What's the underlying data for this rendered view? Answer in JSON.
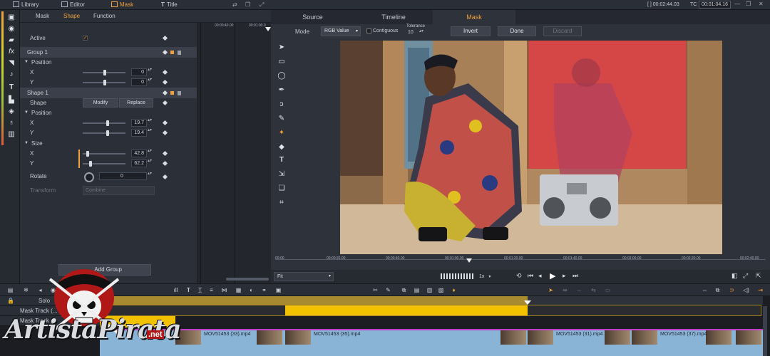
{
  "app": {
    "top_tabs": [
      "Library",
      "Editor",
      "Mask",
      "Title"
    ],
    "active_tab": "Mask",
    "timecode": "[ ] 00:02:44.03",
    "tc_label": "TC",
    "tc_value": "00:01:04.16"
  },
  "panel": {
    "tabs": [
      "Mask",
      "Shape",
      "Function"
    ],
    "active_tab": "Shape",
    "ruler": [
      "00:00:40.00",
      "00:01:00.0"
    ],
    "active_label": "Active",
    "group_label": "Group 1",
    "position_label": "Position",
    "x_label": "X",
    "y_label": "Y",
    "group_pos_x": "0",
    "group_pos_y": "0",
    "shape_label": "Shape 1",
    "shape_row_label": "Shape",
    "modify_btn": "Modify",
    "replace_btn": "Replace",
    "shape_pos_x": "19.7",
    "shape_pos_y": "19.4",
    "size_label": "Size",
    "size_x": "42.8",
    "size_y": "62.2",
    "rotate_label": "Rotate",
    "rotate_value": "0",
    "transform_label": "Transform",
    "transform_value": "Combine",
    "add_group_btn": "Add Group"
  },
  "preview": {
    "tabs": [
      "Source",
      "Timeline",
      "Mask"
    ],
    "active_tab": "Mask",
    "mode_label": "Mode",
    "mode_value": "RGB Value",
    "contiguous_label": "Contiguous",
    "tolerance_label": "Tolerance",
    "tolerance_value": "10",
    "invert_btn": "Invert",
    "done_btn": "Done",
    "discard_btn": "Discard",
    "fit_value": "Fit",
    "speed_value": "1x",
    "ruler": [
      "00:00",
      "00:00:20.00",
      "00:00:40.00",
      "00:01:00.00",
      "00:01:20.00",
      "00:01:40.00",
      "00:02:00.00",
      "00:02:20.00",
      "00:02:40.00"
    ]
  },
  "timeline": {
    "solo_label": "Solo",
    "mask_track_label": "Mask Track (...",
    "mask_track2_label": "Mask Track (...",
    "clips": [
      "MOV51453 (33).mp4",
      "MOV51453 (35).mp4",
      "MOV51453 (31).mp4",
      "MOV51453 (37).mp4"
    ]
  },
  "watermark": {
    "brand": "ArtistaPirata",
    "tld": ".net"
  },
  "colors": {
    "accent": "#f0a03c",
    "clip_blue": "#8ab4d6",
    "mask_track_yellow": "#f2c200",
    "mask_overlay_red": "#e8404a"
  }
}
